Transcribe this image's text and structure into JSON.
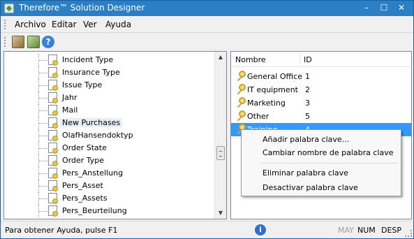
{
  "window": {
    "title": "Therefore™ Solution Designer"
  },
  "menubar": {
    "items": [
      "Archivo",
      "Editar",
      "Ver",
      "Ayuda"
    ]
  },
  "toolbar": {
    "help_glyph": "?"
  },
  "tree": {
    "items": [
      "Incident Type",
      "Insurance Type",
      "Issue Type",
      "Jahr",
      "Mail",
      "New Purchases",
      "OlafHansendoktyp",
      "Order State",
      "Order Type",
      "Pers_Anstellung",
      "Pers_Asset",
      "Pers_Assets",
      "Pers_Beurteilung"
    ],
    "hovered_item": "New Purchases"
  },
  "list": {
    "columns": [
      "Nombre",
      "ID"
    ],
    "rows": [
      {
        "name": "General Office",
        "id": "1"
      },
      {
        "name": "IT equipment",
        "id": "2"
      },
      {
        "name": "Marketing",
        "id": "3"
      },
      {
        "name": "Other",
        "id": "5"
      },
      {
        "name": "Training",
        "id": "4"
      }
    ],
    "selected_index": 4
  },
  "context_menu": {
    "items": [
      "Añadir palabra clave...",
      "Cambiar nombre de palabra clave",
      "Eliminar palabra clave",
      "Desactivar palabra clave"
    ]
  },
  "status": {
    "text": "Para obtener Ayuda, pulse F1",
    "info_glyph": "i",
    "indicators": [
      {
        "label": "MAY",
        "active": false
      },
      {
        "label": "NUM",
        "active": true
      },
      {
        "label": "DESP",
        "active": true
      }
    ]
  },
  "colors": {
    "titlebar": "#2b7fc4",
    "selection": "#3399ff"
  }
}
